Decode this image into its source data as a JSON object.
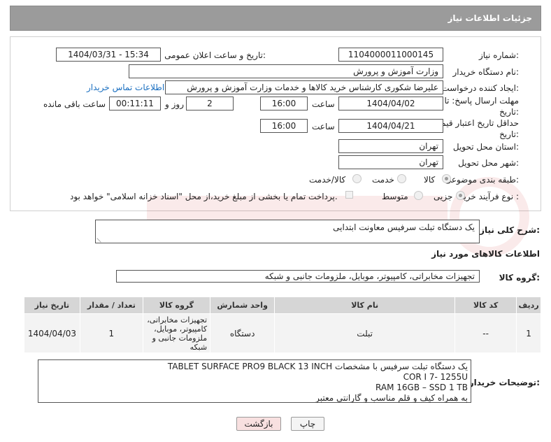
{
  "header": {
    "title": "جزئیات اطلاعات نیاز"
  },
  "form": {
    "need_number_label": "شماره نیاز:",
    "need_number": "1104000011000145",
    "announce_label": "تاریخ و ساعت اعلان عمومی:",
    "announce_value": "1404/03/31 - 15:34",
    "buyer_org_label": "نام دستگاه خریدار:",
    "buyer_org": "وزارت آموزش و پرورش",
    "requester_label": "ایجاد کننده درخواست:",
    "requester": "علیرضا شکوری کارشناس خرید کالاها و خدمات وزارت آموزش و پرورش",
    "contact_link": "اطلاعات تماس خریدار",
    "deadline_label": "مهلت ارسال پاسخ: تا تاریخ:",
    "deadline_date": "1404/04/02",
    "time_label": "ساعت",
    "deadline_time": "16:00",
    "days_value": "2",
    "days_label": "روز و",
    "remaining_time": "00:11:11",
    "remaining_label": "ساعت باقی مانده",
    "min_price_label": "حداقل تاریخ اعتبار قیمت: تا تاریخ:",
    "min_price_date": "1404/04/21",
    "min_price_time": "16:00",
    "province_label": "استان محل تحویل:",
    "province": "تهران",
    "city_label": "شهر محل تحویل:",
    "city": "تهران",
    "category_label": "طبقه بندی موضوعی:",
    "category_options": [
      "کالا",
      "خدمت",
      "کالا/خدمت"
    ],
    "process_label": "نوع فرآیند خرید :",
    "process_options": [
      "جزیی",
      "متوسط"
    ],
    "payment_note": "پرداخت تمام یا بخشی از مبلغ خرید،از محل \"اسناد خزانه اسلامی\" خواهد بود."
  },
  "summary": {
    "label": "شرح کلی نیاز:",
    "value": "یک دستگاه تبلت سرفیس معاونت ابتدایی"
  },
  "goods_info": {
    "title": "اطلاعات کالاهای مورد نیاز",
    "group_label": "گروه کالا:",
    "group_value": "تجهیزات مخابراتی، کامپیوتر، موبایل، ملزومات جانبی و شبکه"
  },
  "table": {
    "headers": [
      "ردیف",
      "کد کالا",
      "نام کالا",
      "واحد شمارش",
      "گروه کالا",
      "تعداد / مقدار",
      "تاریخ نیاز"
    ],
    "rows": [
      [
        "1",
        "--",
        "تبلت",
        "دستگاه",
        "تجهیزات مخابراتی، کامپیوتر، موبایل، ملزومات جانبی و شبکه",
        "1",
        "1404/04/03"
      ]
    ]
  },
  "buyer_notes": {
    "label": "توضیحات خریدار:",
    "lines": [
      "یک دستگاه تبلت سرفیس با مشخصات TABLET SURFACE PRO9 BLACK 13 INCH",
      "COR I 7- 1255U",
      "RAM 16GB – SSD 1 TB",
      "به همراه کیف و قلم مناسب و گارانتی معتبر"
    ]
  },
  "buttons": {
    "print": "چاپ",
    "back": "بازگشت"
  },
  "colors": {
    "header_bg": "#9b9b9b",
    "link": "#1a6fc0",
    "back_button_bg": "#f8e0e0"
  }
}
